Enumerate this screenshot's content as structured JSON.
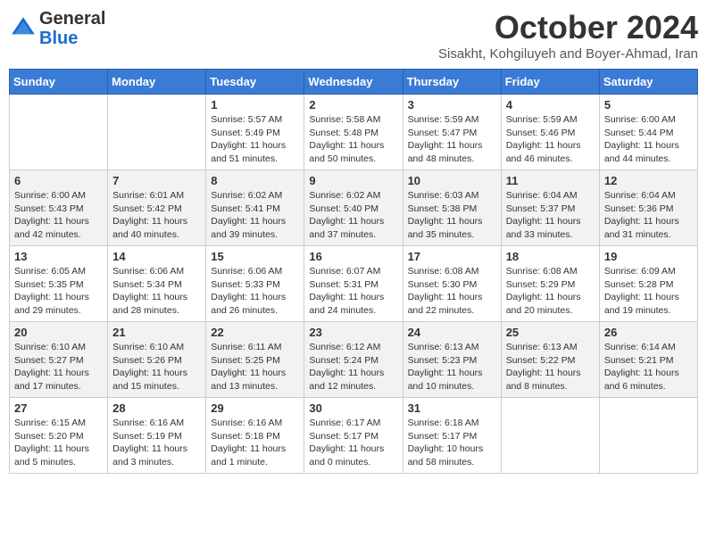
{
  "header": {
    "logo_general": "General",
    "logo_blue": "Blue",
    "month": "October 2024",
    "location": "Sisakht, Kohgiluyeh and Boyer-Ahmad, Iran"
  },
  "days_of_week": [
    "Sunday",
    "Monday",
    "Tuesday",
    "Wednesday",
    "Thursday",
    "Friday",
    "Saturday"
  ],
  "weeks": [
    [
      {
        "day": "",
        "sunrise": "",
        "sunset": "",
        "daylight": ""
      },
      {
        "day": "",
        "sunrise": "",
        "sunset": "",
        "daylight": ""
      },
      {
        "day": "1",
        "sunrise": "Sunrise: 5:57 AM",
        "sunset": "Sunset: 5:49 PM",
        "daylight": "Daylight: 11 hours and 51 minutes."
      },
      {
        "day": "2",
        "sunrise": "Sunrise: 5:58 AM",
        "sunset": "Sunset: 5:48 PM",
        "daylight": "Daylight: 11 hours and 50 minutes."
      },
      {
        "day": "3",
        "sunrise": "Sunrise: 5:59 AM",
        "sunset": "Sunset: 5:47 PM",
        "daylight": "Daylight: 11 hours and 48 minutes."
      },
      {
        "day": "4",
        "sunrise": "Sunrise: 5:59 AM",
        "sunset": "Sunset: 5:46 PM",
        "daylight": "Daylight: 11 hours and 46 minutes."
      },
      {
        "day": "5",
        "sunrise": "Sunrise: 6:00 AM",
        "sunset": "Sunset: 5:44 PM",
        "daylight": "Daylight: 11 hours and 44 minutes."
      }
    ],
    [
      {
        "day": "6",
        "sunrise": "Sunrise: 6:00 AM",
        "sunset": "Sunset: 5:43 PM",
        "daylight": "Daylight: 11 hours and 42 minutes."
      },
      {
        "day": "7",
        "sunrise": "Sunrise: 6:01 AM",
        "sunset": "Sunset: 5:42 PM",
        "daylight": "Daylight: 11 hours and 40 minutes."
      },
      {
        "day": "8",
        "sunrise": "Sunrise: 6:02 AM",
        "sunset": "Sunset: 5:41 PM",
        "daylight": "Daylight: 11 hours and 39 minutes."
      },
      {
        "day": "9",
        "sunrise": "Sunrise: 6:02 AM",
        "sunset": "Sunset: 5:40 PM",
        "daylight": "Daylight: 11 hours and 37 minutes."
      },
      {
        "day": "10",
        "sunrise": "Sunrise: 6:03 AM",
        "sunset": "Sunset: 5:38 PM",
        "daylight": "Daylight: 11 hours and 35 minutes."
      },
      {
        "day": "11",
        "sunrise": "Sunrise: 6:04 AM",
        "sunset": "Sunset: 5:37 PM",
        "daylight": "Daylight: 11 hours and 33 minutes."
      },
      {
        "day": "12",
        "sunrise": "Sunrise: 6:04 AM",
        "sunset": "Sunset: 5:36 PM",
        "daylight": "Daylight: 11 hours and 31 minutes."
      }
    ],
    [
      {
        "day": "13",
        "sunrise": "Sunrise: 6:05 AM",
        "sunset": "Sunset: 5:35 PM",
        "daylight": "Daylight: 11 hours and 29 minutes."
      },
      {
        "day": "14",
        "sunrise": "Sunrise: 6:06 AM",
        "sunset": "Sunset: 5:34 PM",
        "daylight": "Daylight: 11 hours and 28 minutes."
      },
      {
        "day": "15",
        "sunrise": "Sunrise: 6:06 AM",
        "sunset": "Sunset: 5:33 PM",
        "daylight": "Daylight: 11 hours and 26 minutes."
      },
      {
        "day": "16",
        "sunrise": "Sunrise: 6:07 AM",
        "sunset": "Sunset: 5:31 PM",
        "daylight": "Daylight: 11 hours and 24 minutes."
      },
      {
        "day": "17",
        "sunrise": "Sunrise: 6:08 AM",
        "sunset": "Sunset: 5:30 PM",
        "daylight": "Daylight: 11 hours and 22 minutes."
      },
      {
        "day": "18",
        "sunrise": "Sunrise: 6:08 AM",
        "sunset": "Sunset: 5:29 PM",
        "daylight": "Daylight: 11 hours and 20 minutes."
      },
      {
        "day": "19",
        "sunrise": "Sunrise: 6:09 AM",
        "sunset": "Sunset: 5:28 PM",
        "daylight": "Daylight: 11 hours and 19 minutes."
      }
    ],
    [
      {
        "day": "20",
        "sunrise": "Sunrise: 6:10 AM",
        "sunset": "Sunset: 5:27 PM",
        "daylight": "Daylight: 11 hours and 17 minutes."
      },
      {
        "day": "21",
        "sunrise": "Sunrise: 6:10 AM",
        "sunset": "Sunset: 5:26 PM",
        "daylight": "Daylight: 11 hours and 15 minutes."
      },
      {
        "day": "22",
        "sunrise": "Sunrise: 6:11 AM",
        "sunset": "Sunset: 5:25 PM",
        "daylight": "Daylight: 11 hours and 13 minutes."
      },
      {
        "day": "23",
        "sunrise": "Sunrise: 6:12 AM",
        "sunset": "Sunset: 5:24 PM",
        "daylight": "Daylight: 11 hours and 12 minutes."
      },
      {
        "day": "24",
        "sunrise": "Sunrise: 6:13 AM",
        "sunset": "Sunset: 5:23 PM",
        "daylight": "Daylight: 11 hours and 10 minutes."
      },
      {
        "day": "25",
        "sunrise": "Sunrise: 6:13 AM",
        "sunset": "Sunset: 5:22 PM",
        "daylight": "Daylight: 11 hours and 8 minutes."
      },
      {
        "day": "26",
        "sunrise": "Sunrise: 6:14 AM",
        "sunset": "Sunset: 5:21 PM",
        "daylight": "Daylight: 11 hours and 6 minutes."
      }
    ],
    [
      {
        "day": "27",
        "sunrise": "Sunrise: 6:15 AM",
        "sunset": "Sunset: 5:20 PM",
        "daylight": "Daylight: 11 hours and 5 minutes."
      },
      {
        "day": "28",
        "sunrise": "Sunrise: 6:16 AM",
        "sunset": "Sunset: 5:19 PM",
        "daylight": "Daylight: 11 hours and 3 minutes."
      },
      {
        "day": "29",
        "sunrise": "Sunrise: 6:16 AM",
        "sunset": "Sunset: 5:18 PM",
        "daylight": "Daylight: 11 hours and 1 minute."
      },
      {
        "day": "30",
        "sunrise": "Sunrise: 6:17 AM",
        "sunset": "Sunset: 5:17 PM",
        "daylight": "Daylight: 11 hours and 0 minutes."
      },
      {
        "day": "31",
        "sunrise": "Sunrise: 6:18 AM",
        "sunset": "Sunset: 5:17 PM",
        "daylight": "Daylight: 10 hours and 58 minutes."
      },
      {
        "day": "",
        "sunrise": "",
        "sunset": "",
        "daylight": ""
      },
      {
        "day": "",
        "sunrise": "",
        "sunset": "",
        "daylight": ""
      }
    ]
  ]
}
